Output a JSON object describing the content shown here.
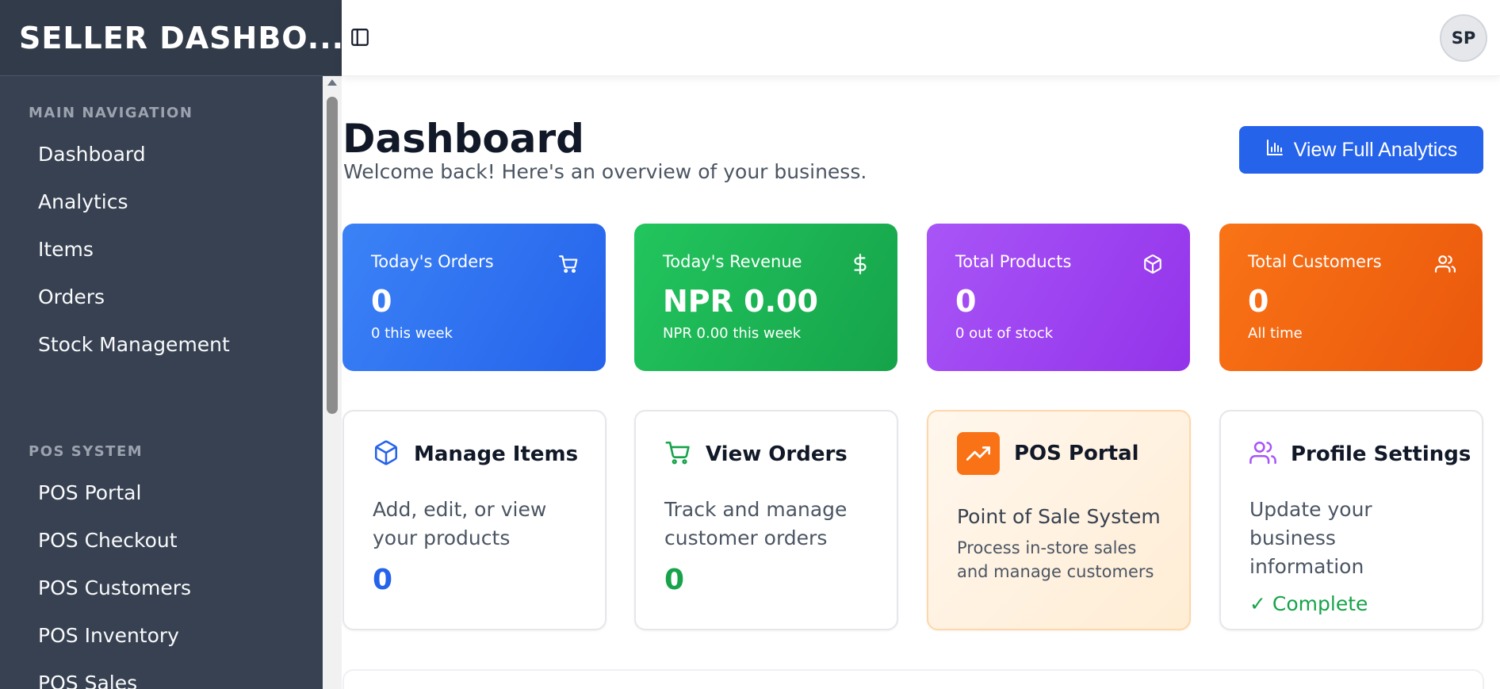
{
  "sidebar": {
    "brand": "SELLER DASHBO...",
    "sections": [
      {
        "heading": "MAIN NAVIGATION",
        "items": [
          "Dashboard",
          "Analytics",
          "Items",
          "Orders",
          "Stock Management"
        ]
      },
      {
        "heading": "POS SYSTEM",
        "items": [
          "POS Portal",
          "POS Checkout",
          "POS Customers",
          "POS Inventory",
          "POS Sales"
        ]
      }
    ]
  },
  "topbar": {
    "avatar_initials": "SP"
  },
  "header": {
    "title": "Dashboard",
    "subtitle": "Welcome back! Here's an overview of your business.",
    "analytics_button": "View Full Analytics"
  },
  "stats": [
    {
      "label": "Today's Orders",
      "value": "0",
      "sub": "0 this week",
      "icon": "cart-icon"
    },
    {
      "label": "Today's Revenue",
      "value": "NPR 0.00",
      "sub": "NPR 0.00 this week",
      "icon": "dollar-icon"
    },
    {
      "label": "Total Products",
      "value": "0",
      "sub": "0 out of stock",
      "icon": "box-icon"
    },
    {
      "label": "Total Customers",
      "value": "0",
      "sub": "All time",
      "icon": "users-icon"
    }
  ],
  "cards": {
    "manage_items": {
      "title": "Manage Items",
      "desc": "Add, edit, or view your products",
      "count": "0"
    },
    "view_orders": {
      "title": "View Orders",
      "desc": "Track and manage customer orders",
      "count": "0"
    },
    "pos_portal": {
      "title": "POS Portal",
      "subtitle": "Point of Sale System",
      "desc": "Process in-store sales and manage customers"
    },
    "profile_settings": {
      "title": "Profile Settings",
      "desc": "Update your business information",
      "status": "✓ Complete"
    }
  },
  "colors": {
    "sidebar_bg": "#374151",
    "accent_blue": "#2563eb",
    "green": "#16a34a",
    "purple": "#9333ea",
    "orange": "#ea580c"
  }
}
